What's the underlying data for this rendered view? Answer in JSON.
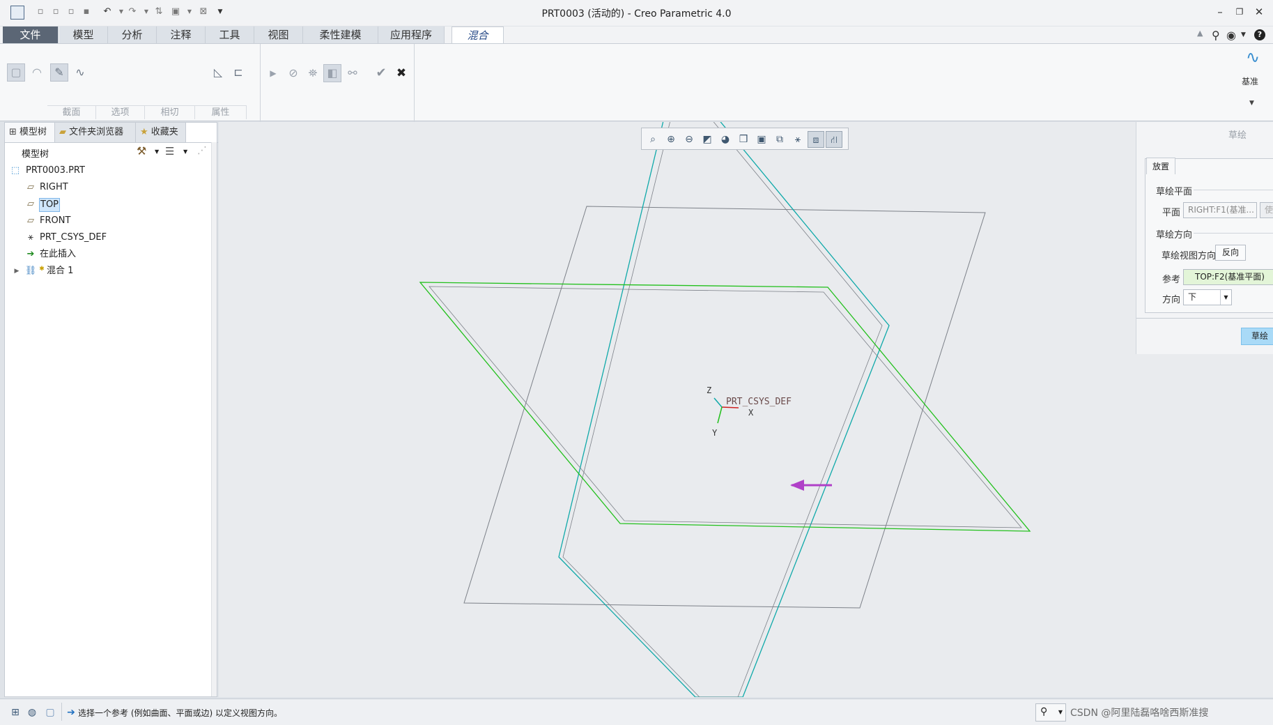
{
  "window": {
    "title": "PRT0003 (活动的) - Creo Parametric 4.0",
    "controls": [
      "minimize-icon",
      "maximize-icon",
      "close-icon"
    ]
  },
  "tabs": [
    {
      "label": "文件"
    },
    {
      "label": "模型"
    },
    {
      "label": "分析"
    },
    {
      "label": "注释"
    },
    {
      "label": "工具"
    },
    {
      "label": "视图"
    },
    {
      "label": "柔性建模"
    },
    {
      "label": "应用程序"
    },
    {
      "label": "混合"
    }
  ],
  "ribbon": {
    "groups": [
      "截面",
      "选项",
      "相切",
      "属性"
    ],
    "datum_label": "基准"
  },
  "left_panel": {
    "tabs": [
      "模型树",
      "文件夹浏览器",
      "收藏夹"
    ],
    "header": "模型树",
    "tree": {
      "root": "PRT0003.PRT",
      "items": [
        "RIGHT",
        "TOP",
        "FRONT",
        "PRT_CSYS_DEF",
        "在此插入",
        "混合 1"
      ]
    }
  },
  "viewport": {
    "csys_label": "PRT_CSYS_DEF",
    "axes": {
      "x": "X",
      "y": "Y",
      "z": "Z"
    },
    "colors": {
      "background": "#e9ebee",
      "green_plane": "#22c01c",
      "cyan_plane": "#0fa9a9",
      "gray_plane": "#7c8088",
      "arrow": "#b040c8"
    }
  },
  "sketch_panel": {
    "title": "草绘",
    "tab": "放置",
    "section_plane": "草绘平面",
    "plane_label": "平面",
    "plane_value": "RIGHT:F1(基准...",
    "use_prev": "使",
    "section_orient": "草绘方向",
    "view_dir_label": "草绘视图方向",
    "flip_button": "反向",
    "reference_label": "参考",
    "reference_value": "TOP:F2(基准平面)",
    "direction_label": "方向",
    "direction_value": "下",
    "sketch_button": "草绘"
  },
  "status": {
    "message": "选择一个参考 (例如曲面、平面或边) 以定义视图方向。",
    "watermark": "CSDN @阿里陆磊咯啥西斯准搜"
  }
}
